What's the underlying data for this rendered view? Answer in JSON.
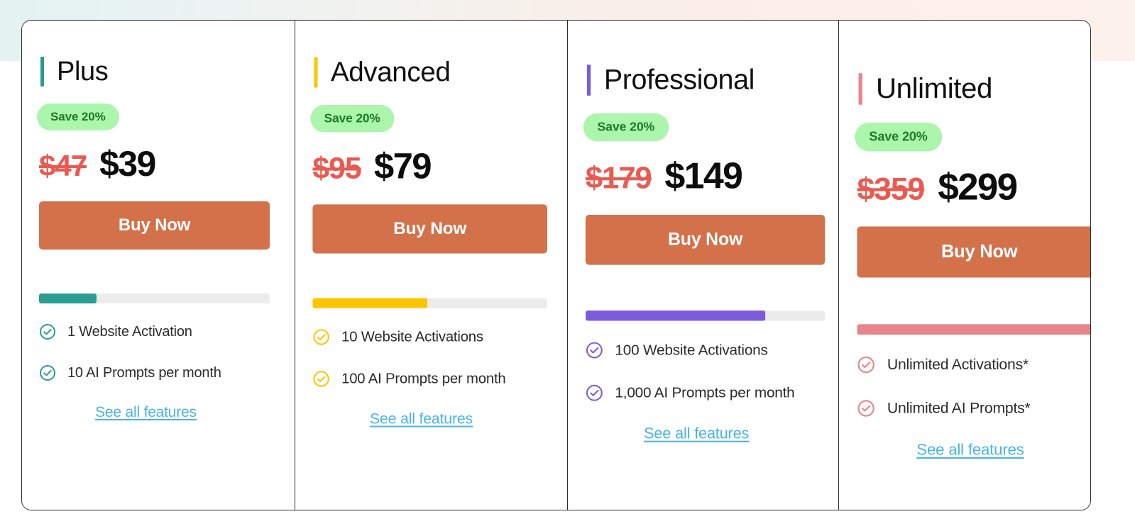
{
  "theme": {
    "card_border": "#2c2c2c",
    "badge_bg": "#abf5ad",
    "badge_text": "#1a7c23",
    "old_price_color": "#ea5a51",
    "new_price_color": "#0d0d0d",
    "buy_button_bg": "#d3714a",
    "buy_button_text": "#ffffff",
    "meter_track": "#ececec",
    "link_color": "#4ab3e8"
  },
  "plans": [
    {
      "name": "Plus",
      "accent": "#2a9d8f",
      "badge": "Save 20%",
      "old_price": "$47",
      "new_price": "$39",
      "buy_label": "Buy Now",
      "meter_percent": 25,
      "check_icon": "check-circle-icon",
      "features": [
        "1 Website Activation",
        "10 AI Prompts per month"
      ],
      "see_all_label": "See all features"
    },
    {
      "name": "Advanced",
      "accent": "#fdc500",
      "badge": "Save 20%",
      "old_price": "$95",
      "new_price": "$79",
      "buy_label": "Buy Now",
      "meter_percent": 49,
      "check_icon": "check-circle-icon",
      "features": [
        "10 Website Activations",
        "100 AI Prompts per month"
      ],
      "see_all_label": "See all features"
    },
    {
      "name": "Professional",
      "accent": "#7c5cdb",
      "badge": "Save 20%",
      "old_price": "$179",
      "new_price": "$149",
      "buy_label": "Buy Now",
      "meter_percent": 75,
      "check_icon": "check-circle-icon",
      "features": [
        "100 Website Activations",
        "1,000 AI Prompts per month"
      ],
      "see_all_label": "See all features"
    },
    {
      "name": "Unlimited",
      "accent": "#e8848a",
      "badge": "Save 20%",
      "old_price": "$359",
      "new_price": "$299",
      "buy_label": "Buy Now",
      "meter_percent": 100,
      "check_icon": "check-circle-icon",
      "features": [
        "Unlimited Activations*",
        "Unlimited AI Prompts*"
      ],
      "see_all_label": "See all features"
    }
  ]
}
